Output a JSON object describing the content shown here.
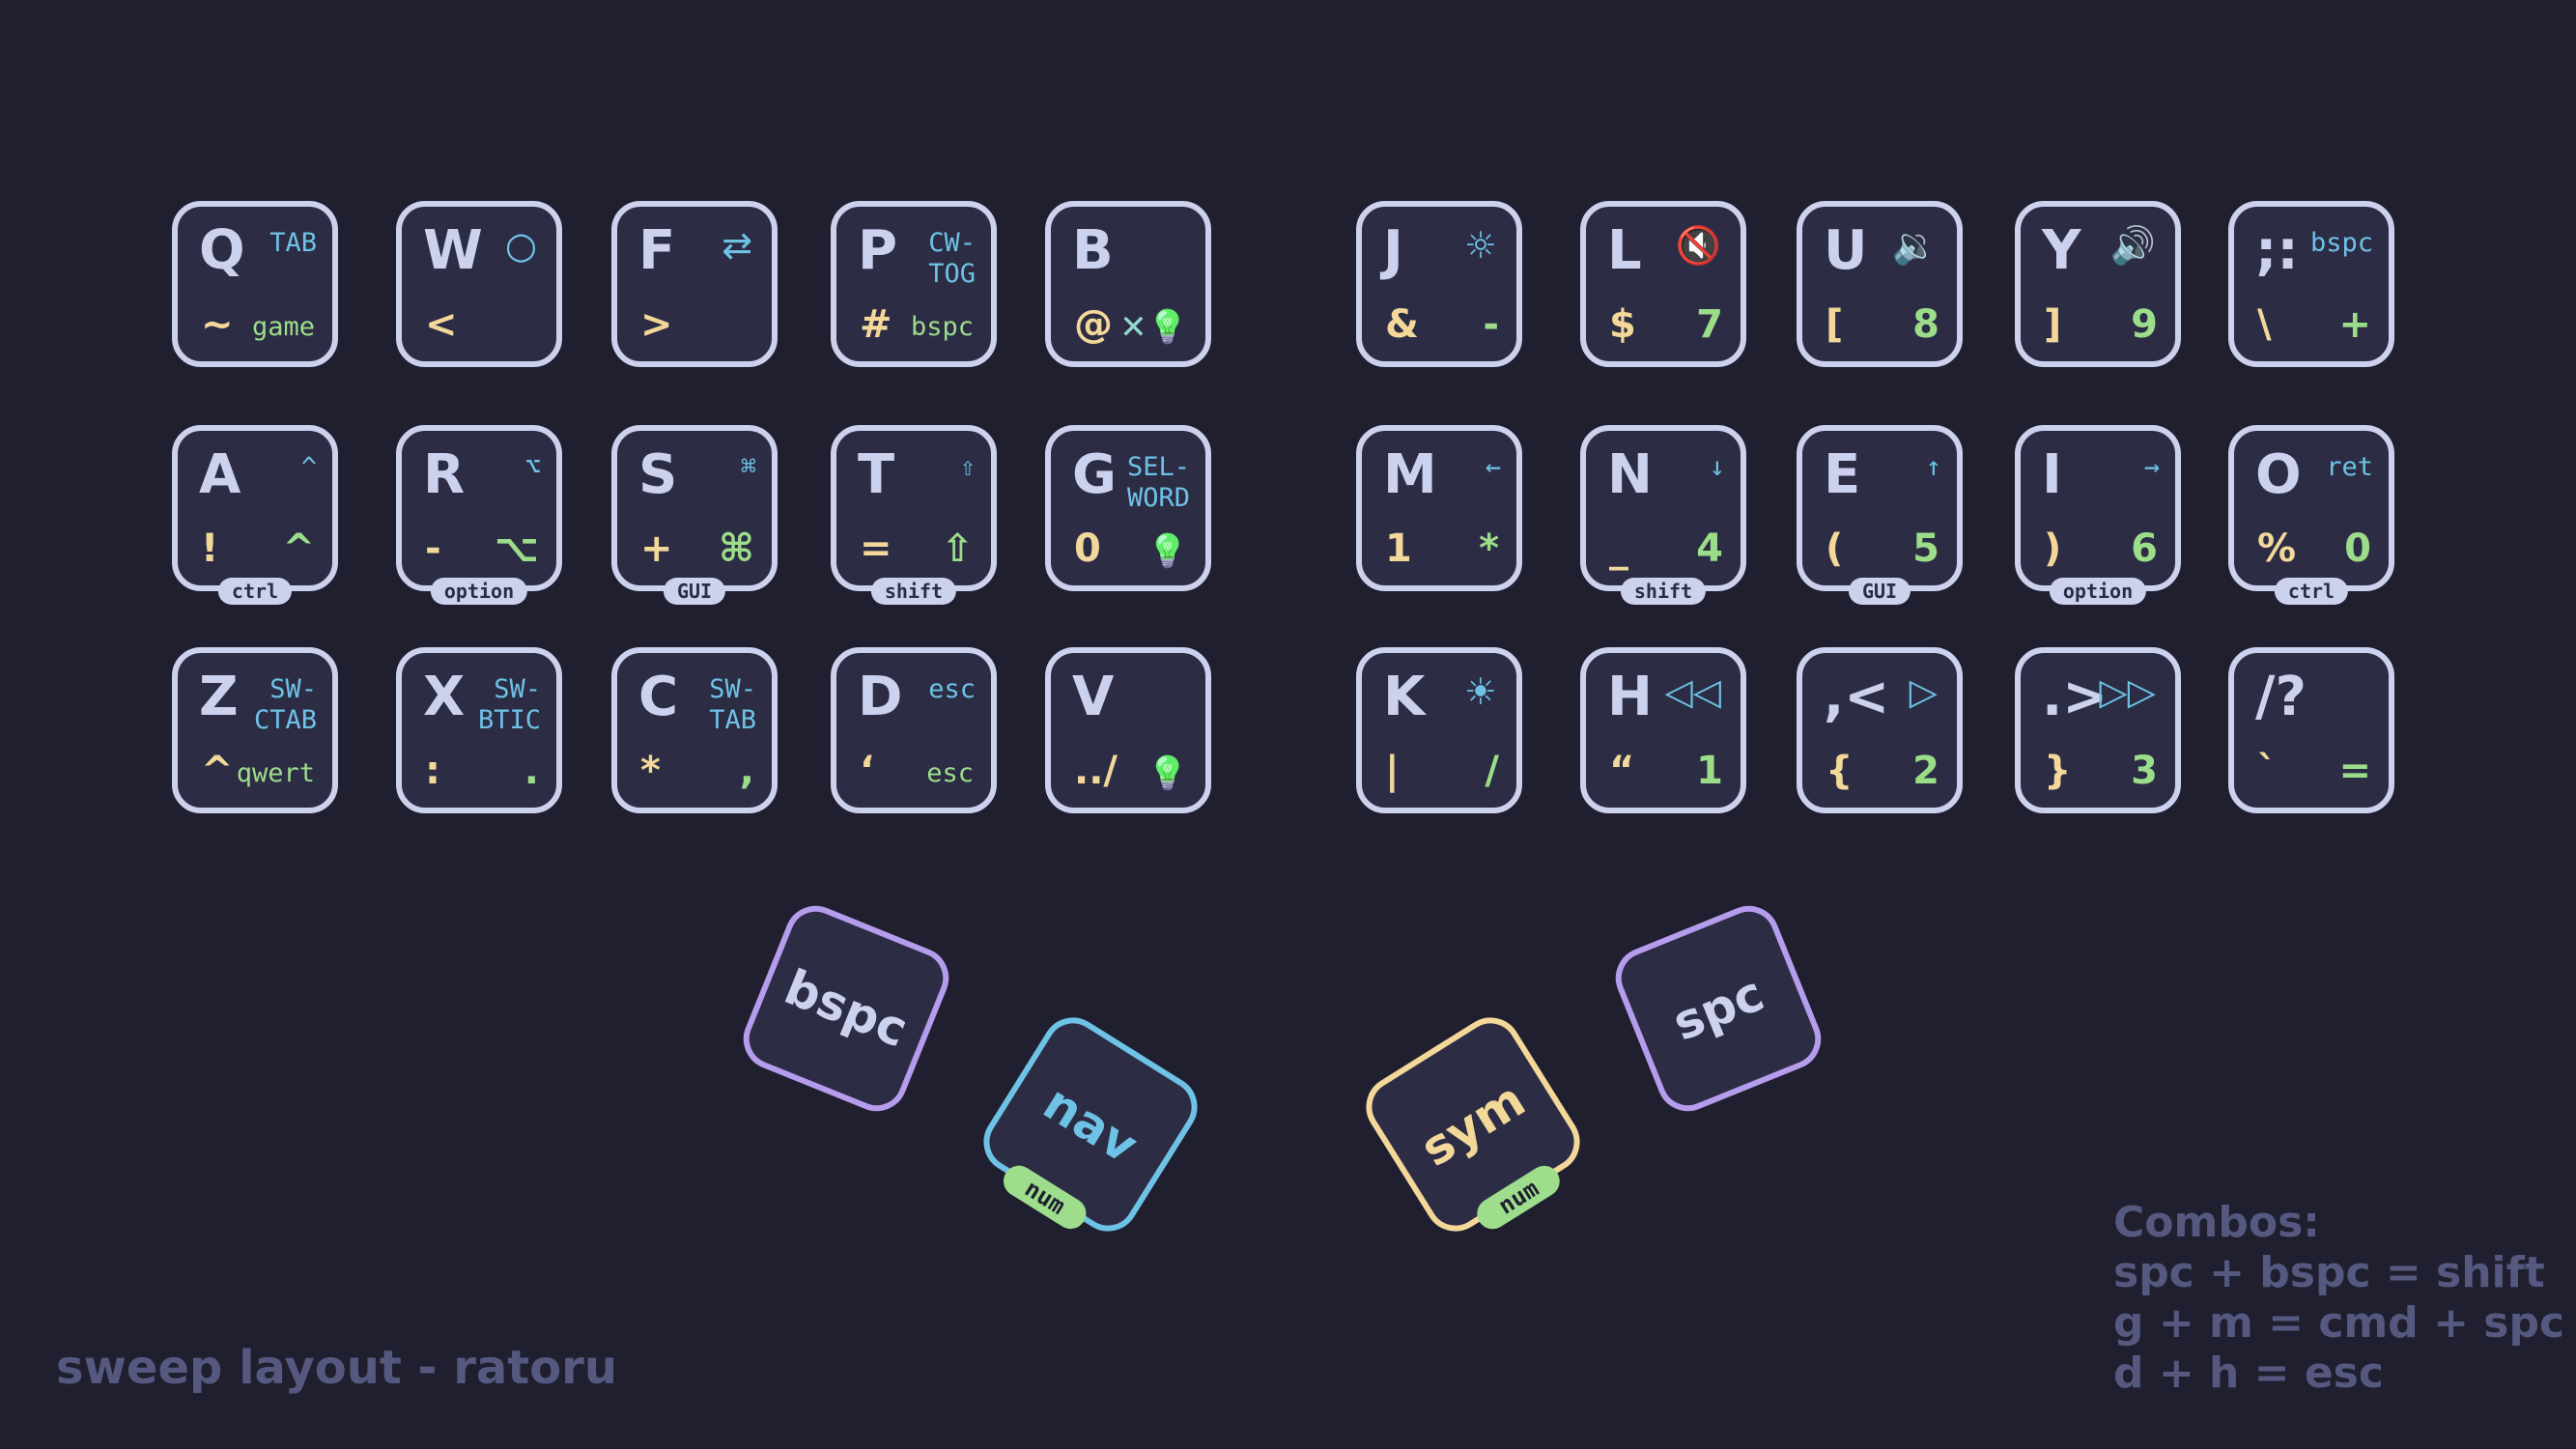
{
  "title": "sweep layout - ratoru",
  "colors": {
    "background": "#1f1f2f",
    "key_fill": "#2c2d45",
    "key_border": "#ccd1ee",
    "base_layer": "#ccd1ee",
    "nav_layer": "#6ec2e6",
    "sym_layer": "#f3d899",
    "num_layer": "#9cdd8a",
    "thumb_outer": "#b59cec",
    "footer_text": "#55597f"
  },
  "left_keys": [
    {
      "main": "Q",
      "tr": "TAB",
      "bl": "~",
      "br": "game",
      "tr_type": "word",
      "br_type": "word",
      "icon": ""
    },
    {
      "main": "W",
      "tr": "○",
      "bl": "<",
      "br": "",
      "tr_type": "icon",
      "icon": "circle-icon"
    },
    {
      "main": "F",
      "tr": "⇄",
      "bl": ">",
      "br": "",
      "tr_type": "icon",
      "icon": "repeat-icon"
    },
    {
      "main": "P",
      "tr": "CW-\nTOG",
      "bl": "#",
      "br": "bspc",
      "tr_type": "word",
      "br_type": "word"
    },
    {
      "main": "B",
      "tr": "",
      "bl": "@",
      "br": "✕💡",
      "br_type": "icon",
      "icon": "light-off-icon"
    },
    {
      "main": "A",
      "tr": "^",
      "bl": "!",
      "br": "^",
      "hold": "ctrl"
    },
    {
      "main": "R",
      "tr": "⌥",
      "bl": "-",
      "br": "⌥",
      "hold": "option"
    },
    {
      "main": "S",
      "tr": "⌘",
      "bl": "+",
      "br": "⌘",
      "hold": "GUI"
    },
    {
      "main": "T",
      "tr": "⇧",
      "bl": "=",
      "br": "⇧",
      "hold": "shift"
    },
    {
      "main": "G",
      "tr": "SEL-\nWORD",
      "bl": "0",
      "br": "💡",
      "tr_type": "word",
      "br_type": "icon",
      "icon": "light-on-icon"
    },
    {
      "main": "Z",
      "tr": "SW-\nCTAB",
      "bl": "^",
      "br": "qwert",
      "tr_type": "word",
      "br_type": "word"
    },
    {
      "main": "X",
      "tr": "SW-\nBTIC",
      "bl": ":",
      "br": ".",
      "tr_type": "word"
    },
    {
      "main": "C",
      "tr": "SW-\nTAB",
      "bl": "*",
      "br": ",",
      "tr_type": "word"
    },
    {
      "main": "D",
      "tr": "esc",
      "bl": "‘",
      "br": "esc",
      "tr_type": "word",
      "br_type": "word"
    },
    {
      "main": "V",
      "tr": "",
      "bl": "../",
      "br": "💡",
      "br_type": "icon",
      "icon": "light-toggle-icon"
    }
  ],
  "right_keys": [
    {
      "main": "J",
      "tr": "☼",
      "bl": "&",
      "br": "-",
      "tr_type": "icon",
      "icon": "brightness-up-icon"
    },
    {
      "main": "L",
      "tr": "🔇",
      "bl": "$",
      "br": "7",
      "tr_type": "icon",
      "icon": "mute-icon"
    },
    {
      "main": "U",
      "tr": "🔉",
      "bl": "[",
      "br": "8",
      "tr_type": "icon",
      "icon": "volume-down-icon"
    },
    {
      "main": "Y",
      "tr": "🔊",
      "bl": "]",
      "br": "9",
      "tr_type": "icon",
      "icon": "volume-up-icon"
    },
    {
      "main": ";:",
      "tr": "bspc",
      "bl": "\\",
      "br": "+",
      "tr_type": "word"
    },
    {
      "main": "M",
      "tr": "←",
      "bl": "1",
      "br": "*"
    },
    {
      "main": "N",
      "tr": "↓",
      "bl": "_",
      "br": "4",
      "hold": "shift"
    },
    {
      "main": "E",
      "tr": "↑",
      "bl": "(",
      "br": "5",
      "hold": "GUI"
    },
    {
      "main": "I",
      "tr": "→",
      "bl": ")",
      "br": "6",
      "hold": "option"
    },
    {
      "main": "O",
      "tr": "ret",
      "bl": "%",
      "br": "0",
      "hold": "ctrl",
      "tr_type": "word"
    },
    {
      "main": "K",
      "tr": "☀",
      "bl": "|",
      "br": "/",
      "tr_type": "icon",
      "icon": "brightness-down-icon"
    },
    {
      "main": "H",
      "tr": "◁◁",
      "bl": "“",
      "br": "1",
      "tr_type": "icon",
      "icon": "previous-track-icon"
    },
    {
      "main": ",<",
      "tr": "▷",
      "bl": "{",
      "br": "2",
      "tr_type": "icon",
      "icon": "play-icon"
    },
    {
      "main": ".>",
      "tr": "▷▷",
      "bl": "}",
      "br": "3",
      "tr_type": "icon",
      "icon": "next-track-icon"
    },
    {
      "main": "/?",
      "tr": "",
      "bl": "`",
      "br": "="
    }
  ],
  "thumbs": [
    {
      "label": "bspc",
      "hold": "",
      "border": "#b59cec",
      "color": "#ccd1ee"
    },
    {
      "label": "nav",
      "hold": "num",
      "border": "#6ec2e6",
      "color": "#6ec2e6"
    },
    {
      "label": "sym",
      "hold": "num",
      "border": "#f3d899",
      "color": "#f3d899"
    },
    {
      "label": "spc",
      "hold": "",
      "border": "#b59cec",
      "color": "#ccd1ee"
    }
  ],
  "combos": {
    "heading": "Combos:",
    "lines": [
      "spc + bspc = shift",
      "g + m = cmd + spc",
      "d + h = esc"
    ]
  }
}
